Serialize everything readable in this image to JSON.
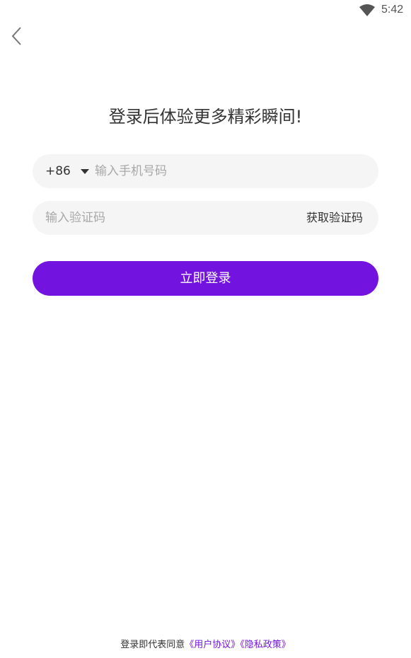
{
  "status_bar": {
    "time": "5:42",
    "wifi_icon": "wifi-icon"
  },
  "nav": {
    "back_icon": "chevron-left-icon"
  },
  "title": "登录后体验更多精彩瞬间!",
  "phone": {
    "country_code": "+86",
    "dropdown_icon": "caret-down-icon",
    "placeholder": "输入手机号码"
  },
  "code": {
    "placeholder": "输入验证码",
    "get_code_label": "获取验证码"
  },
  "login_button": "立即登录",
  "agreement": {
    "prefix": "登录即代表同意",
    "user_agreement": "《用户协议》",
    "privacy_policy": "《隐私政策》"
  },
  "colors": {
    "accent": "#7313e0",
    "field_bg": "#f5f5f5"
  }
}
